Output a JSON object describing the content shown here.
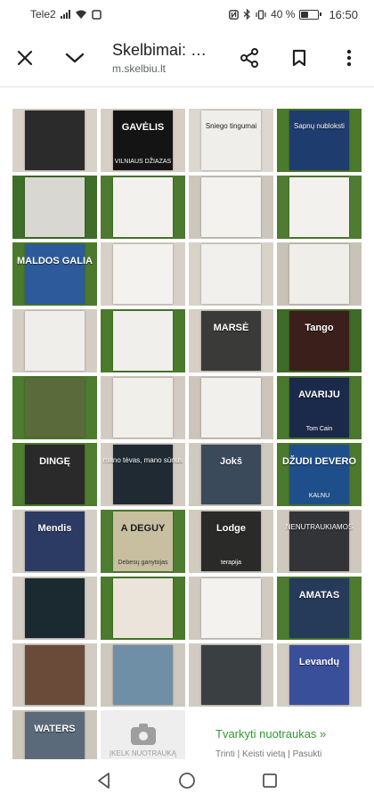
{
  "status_bar": {
    "carrier": "Tele2",
    "battery": "40 %",
    "battery_level": 0.4,
    "time": "16:50"
  },
  "toolbar": {
    "title": "Skelbimai: …",
    "url": "m.skelbiu.lt",
    "icons": [
      "close-icon",
      "chevron-down-icon",
      "share-icon",
      "bookmark-icon",
      "more-vert-icon"
    ]
  },
  "gallery": {
    "items": [
      {
        "title": "",
        "subtitle": "",
        "bg": "#d8d2c8",
        "cover": "#2b2b2b"
      },
      {
        "title": "GAVĖLIS",
        "subtitle": "VILNIAUS DŽIAZAS",
        "bg": "#d7cfc6",
        "cover": "#141414"
      },
      {
        "title": "Sniego tingumai",
        "subtitle": "",
        "bg": "#dcd7cf",
        "cover": "#efeeea"
      },
      {
        "title": "Sapnų nubloksti",
        "subtitle": "",
        "bg": "#4a7a2a",
        "cover": "#1f3c6e"
      },
      {
        "title": "",
        "subtitle": "",
        "bg": "#3f6d2a",
        "cover": "#d9d7d2"
      },
      {
        "title": "",
        "subtitle": "",
        "bg": "#4b7a30",
        "cover": "#f2f1ee"
      },
      {
        "title": "",
        "subtitle": "",
        "bg": "#cdc6bc",
        "cover": "#f4f2ee"
      },
      {
        "title": "",
        "subtitle": "",
        "bg": "#4f7c32",
        "cover": "#f2f1ee"
      },
      {
        "title": "MALDOS GALIA",
        "subtitle": "",
        "bg": "#4b7a2e",
        "cover": "#2c5a9a"
      },
      {
        "title": "",
        "subtitle": "",
        "bg": "#d6d0c6",
        "cover": "#f3f2ef"
      },
      {
        "title": "",
        "subtitle": "",
        "bg": "#d8d2c9",
        "cover": "#f1f0ec"
      },
      {
        "title": "",
        "subtitle": "",
        "bg": "#c9c2b7",
        "cover": "#efeee9"
      },
      {
        "title": "",
        "subtitle": "",
        "bg": "#d4cdc3",
        "cover": "#efeeea"
      },
      {
        "title": "",
        "subtitle": "",
        "bg": "#4a7a2c",
        "cover": "#f0efeb"
      },
      {
        "title": "MARSĖ",
        "subtitle": "",
        "bg": "#d6cfc5",
        "cover": "#3a3a38"
      },
      {
        "title": "Tango",
        "subtitle": "",
        "bg": "#3e6b27",
        "cover": "#3a1f1a"
      },
      {
        "title": "",
        "subtitle": "",
        "bg": "#4d7c2f",
        "cover": "#5a6a3a"
      },
      {
        "title": "",
        "subtitle": "",
        "bg": "#d2cbc1",
        "cover": "#f0efea"
      },
      {
        "title": "",
        "subtitle": "",
        "bg": "#cdc5bb",
        "cover": "#f1f0ec"
      },
      {
        "title": "AVARIJU",
        "subtitle": "Tom Cain",
        "bg": "#4a782d",
        "cover": "#1b2a4a"
      },
      {
        "title": "DINGĘ",
        "subtitle": "",
        "bg": "#4f7e31",
        "cover": "#2a2a2a"
      },
      {
        "title": "mano tėvas, mano sūnus",
        "subtitle": "",
        "bg": "#d3ccc2",
        "cover": "#1f2a33"
      },
      {
        "title": "Jokš",
        "subtitle": "",
        "bg": "#d0c9bf",
        "cover": "#3b4a5a"
      },
      {
        "title": "DŽUDI DEVERO",
        "subtitle": "KALNU",
        "bg": "#4b792d",
        "cover": "#1f4f8a"
      },
      {
        "title": "Mendis",
        "subtitle": "",
        "bg": "#d5cec4",
        "cover": "#2b3b63"
      },
      {
        "title": "A DEGUY",
        "subtitle": "Debesų ganytojas",
        "bg": "#4e7d31",
        "cover": "#c8bfa0"
      },
      {
        "title": "Lodge",
        "subtitle": "terapija",
        "bg": "#d2cbc0",
        "cover": "#2a2a28"
      },
      {
        "title": "NENUTRAUKIAMOS",
        "subtitle": "",
        "bg": "#cfc8be",
        "cover": "#333438"
      },
      {
        "title": "",
        "subtitle": "",
        "bg": "#d4cdc4",
        "cover": "#1a2a30"
      },
      {
        "title": "",
        "subtitle": "",
        "bg": "#4a7a2c",
        "cover": "#eae4da"
      },
      {
        "title": "",
        "subtitle": "",
        "bg": "#d1cac0",
        "cover": "#f4f2ee"
      },
      {
        "title": "AMATAS",
        "subtitle": "",
        "bg": "#4d7c30",
        "cover": "#263a5a"
      },
      {
        "title": "",
        "subtitle": "",
        "bg": "#d3ccc2",
        "cover": "#6a4a38"
      },
      {
        "title": "",
        "subtitle": "",
        "bg": "#cfc8be",
        "cover": "#6f8fa6"
      },
      {
        "title": "",
        "subtitle": "",
        "bg": "#d2cbc1",
        "cover": "#3a3f42"
      },
      {
        "title": "Levandų",
        "subtitle": "",
        "bg": "#d4cdc3",
        "cover": "#3a4f9a"
      },
      {
        "title": "WATERS",
        "subtitle": "",
        "bg": "#cdc6bb",
        "cover": "#5a6a7a"
      }
    ],
    "placeholder_label": "ĮKELK NUOTRAUKĄ"
  },
  "actions": {
    "edit": "Tvarkyti nuotraukas »",
    "delete": "Trinti",
    "move": "Keisti vietą",
    "rotate": "Pasukti",
    "separator": "|"
  },
  "navbar": {
    "icons": [
      "back-triangle-icon",
      "home-circle-icon",
      "recents-square-icon"
    ]
  }
}
